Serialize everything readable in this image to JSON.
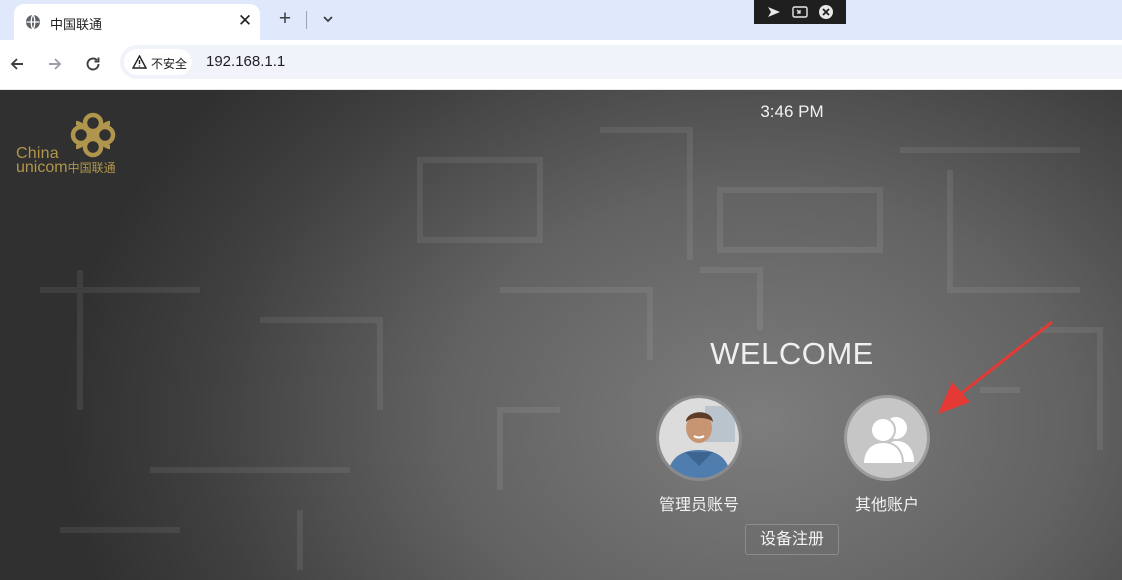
{
  "browser": {
    "tab": {
      "title": "中国联通",
      "close_glyph": "✕"
    },
    "new_tab_glyph": "+",
    "security_label": "不安全",
    "url": "192.168.1.1"
  },
  "page": {
    "logo": {
      "text_line1": "China",
      "text_line2": "unicom",
      "text_cn": "中国联通",
      "color": "#b0954c"
    },
    "clock": "3:46 PM",
    "welcome": "WELCOME",
    "accounts": [
      {
        "label": "管理员账号",
        "icon": "admin-photo-avatar"
      },
      {
        "label": "其他账户",
        "icon": "users-icon"
      }
    ],
    "register_button": "设备注册",
    "annotation_color": "#e53935"
  }
}
